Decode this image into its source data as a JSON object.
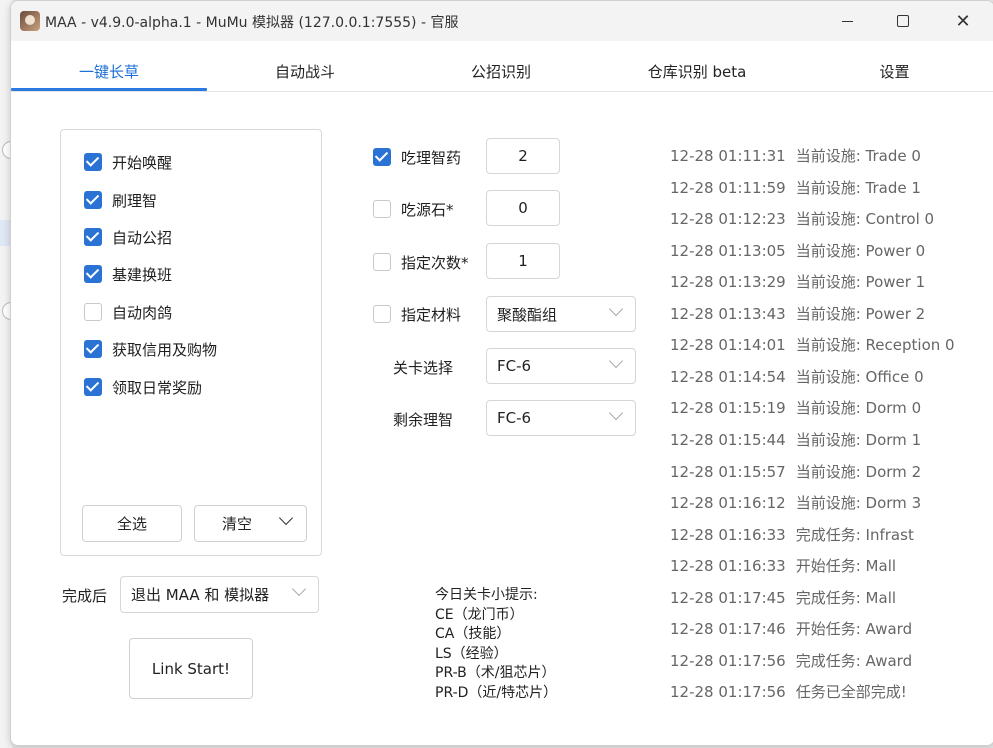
{
  "window": {
    "title": "MAA - v4.9.0-alpha.1 - MuMu 模拟器 (127.0.0.1:7555) - 官服"
  },
  "tabs": [
    {
      "label": "一键长草",
      "active": true
    },
    {
      "label": "自动战斗",
      "active": false
    },
    {
      "label": "公招识别",
      "active": false
    },
    {
      "label": "仓库识别 beta",
      "active": false
    },
    {
      "label": "设置",
      "active": false
    }
  ],
  "tasks": [
    {
      "label": "开始唤醒",
      "checked": true
    },
    {
      "label": "刷理智",
      "checked": true
    },
    {
      "label": "自动公招",
      "checked": true
    },
    {
      "label": "基建换班",
      "checked": true
    },
    {
      "label": "自动肉鸽",
      "checked": false
    },
    {
      "label": "获取信用及购物",
      "checked": true
    },
    {
      "label": "领取日常奖励",
      "checked": true
    }
  ],
  "task_buttons": {
    "select_all": "全选",
    "clear": "清空"
  },
  "after_finish": {
    "label": "完成后",
    "value": "退出 MAA 和 模拟器"
  },
  "start_button": "Link Start!",
  "settings": {
    "medicine": {
      "label": "吃理智药",
      "checked": true,
      "value": "2"
    },
    "stone": {
      "label": "吃源石*",
      "checked": false,
      "value": "0"
    },
    "times": {
      "label": "指定次数*",
      "checked": false,
      "value": "1"
    },
    "material": {
      "label": "指定材料",
      "checked": false,
      "value": "聚酸酯组"
    },
    "stage": {
      "label": "关卡选择",
      "value": "FC-6"
    },
    "remaining": {
      "label": "剩余理智",
      "value": "FC-6"
    }
  },
  "tips": {
    "title": "今日关卡小提示:",
    "lines": [
      "CE（龙门币）",
      "CA（技能）",
      "LS（经验）",
      "PR-B（术/狙芯片）",
      "PR-D（近/特芯片）"
    ]
  },
  "log": [
    {
      "time": "12-28  01:11:31",
      "text": "当前设施: Trade 0"
    },
    {
      "time": "12-28  01:11:59",
      "text": "当前设施: Trade 1"
    },
    {
      "time": "12-28  01:12:23",
      "text": "当前设施: Control 0"
    },
    {
      "time": "12-28  01:13:05",
      "text": "当前设施: Power 0"
    },
    {
      "time": "12-28  01:13:29",
      "text": "当前设施: Power 1"
    },
    {
      "time": "12-28  01:13:43",
      "text": "当前设施: Power 2"
    },
    {
      "time": "12-28  01:14:01",
      "text": "当前设施: Reception 0"
    },
    {
      "time": "12-28  01:14:54",
      "text": "当前设施: Office 0"
    },
    {
      "time": "12-28  01:15:19",
      "text": "当前设施: Dorm 0"
    },
    {
      "time": "12-28  01:15:44",
      "text": "当前设施: Dorm 1"
    },
    {
      "time": "12-28  01:15:57",
      "text": "当前设施: Dorm 2"
    },
    {
      "time": "12-28  01:16:12",
      "text": "当前设施: Dorm 3"
    },
    {
      "time": "12-28  01:16:33",
      "text": "完成任务: Infrast"
    },
    {
      "time": "12-28  01:16:33",
      "text": "开始任务: Mall"
    },
    {
      "time": "12-28  01:17:45",
      "text": "完成任务: Mall"
    },
    {
      "time": "12-28  01:17:46",
      "text": "开始任务: Award"
    },
    {
      "time": "12-28  01:17:56",
      "text": "完成任务: Award"
    },
    {
      "time": "12-28  01:17:56",
      "text": "任务已全部完成!"
    }
  ],
  "colors": {
    "accent": "#2a72d4",
    "tab_active": "#1a6fd8"
  }
}
